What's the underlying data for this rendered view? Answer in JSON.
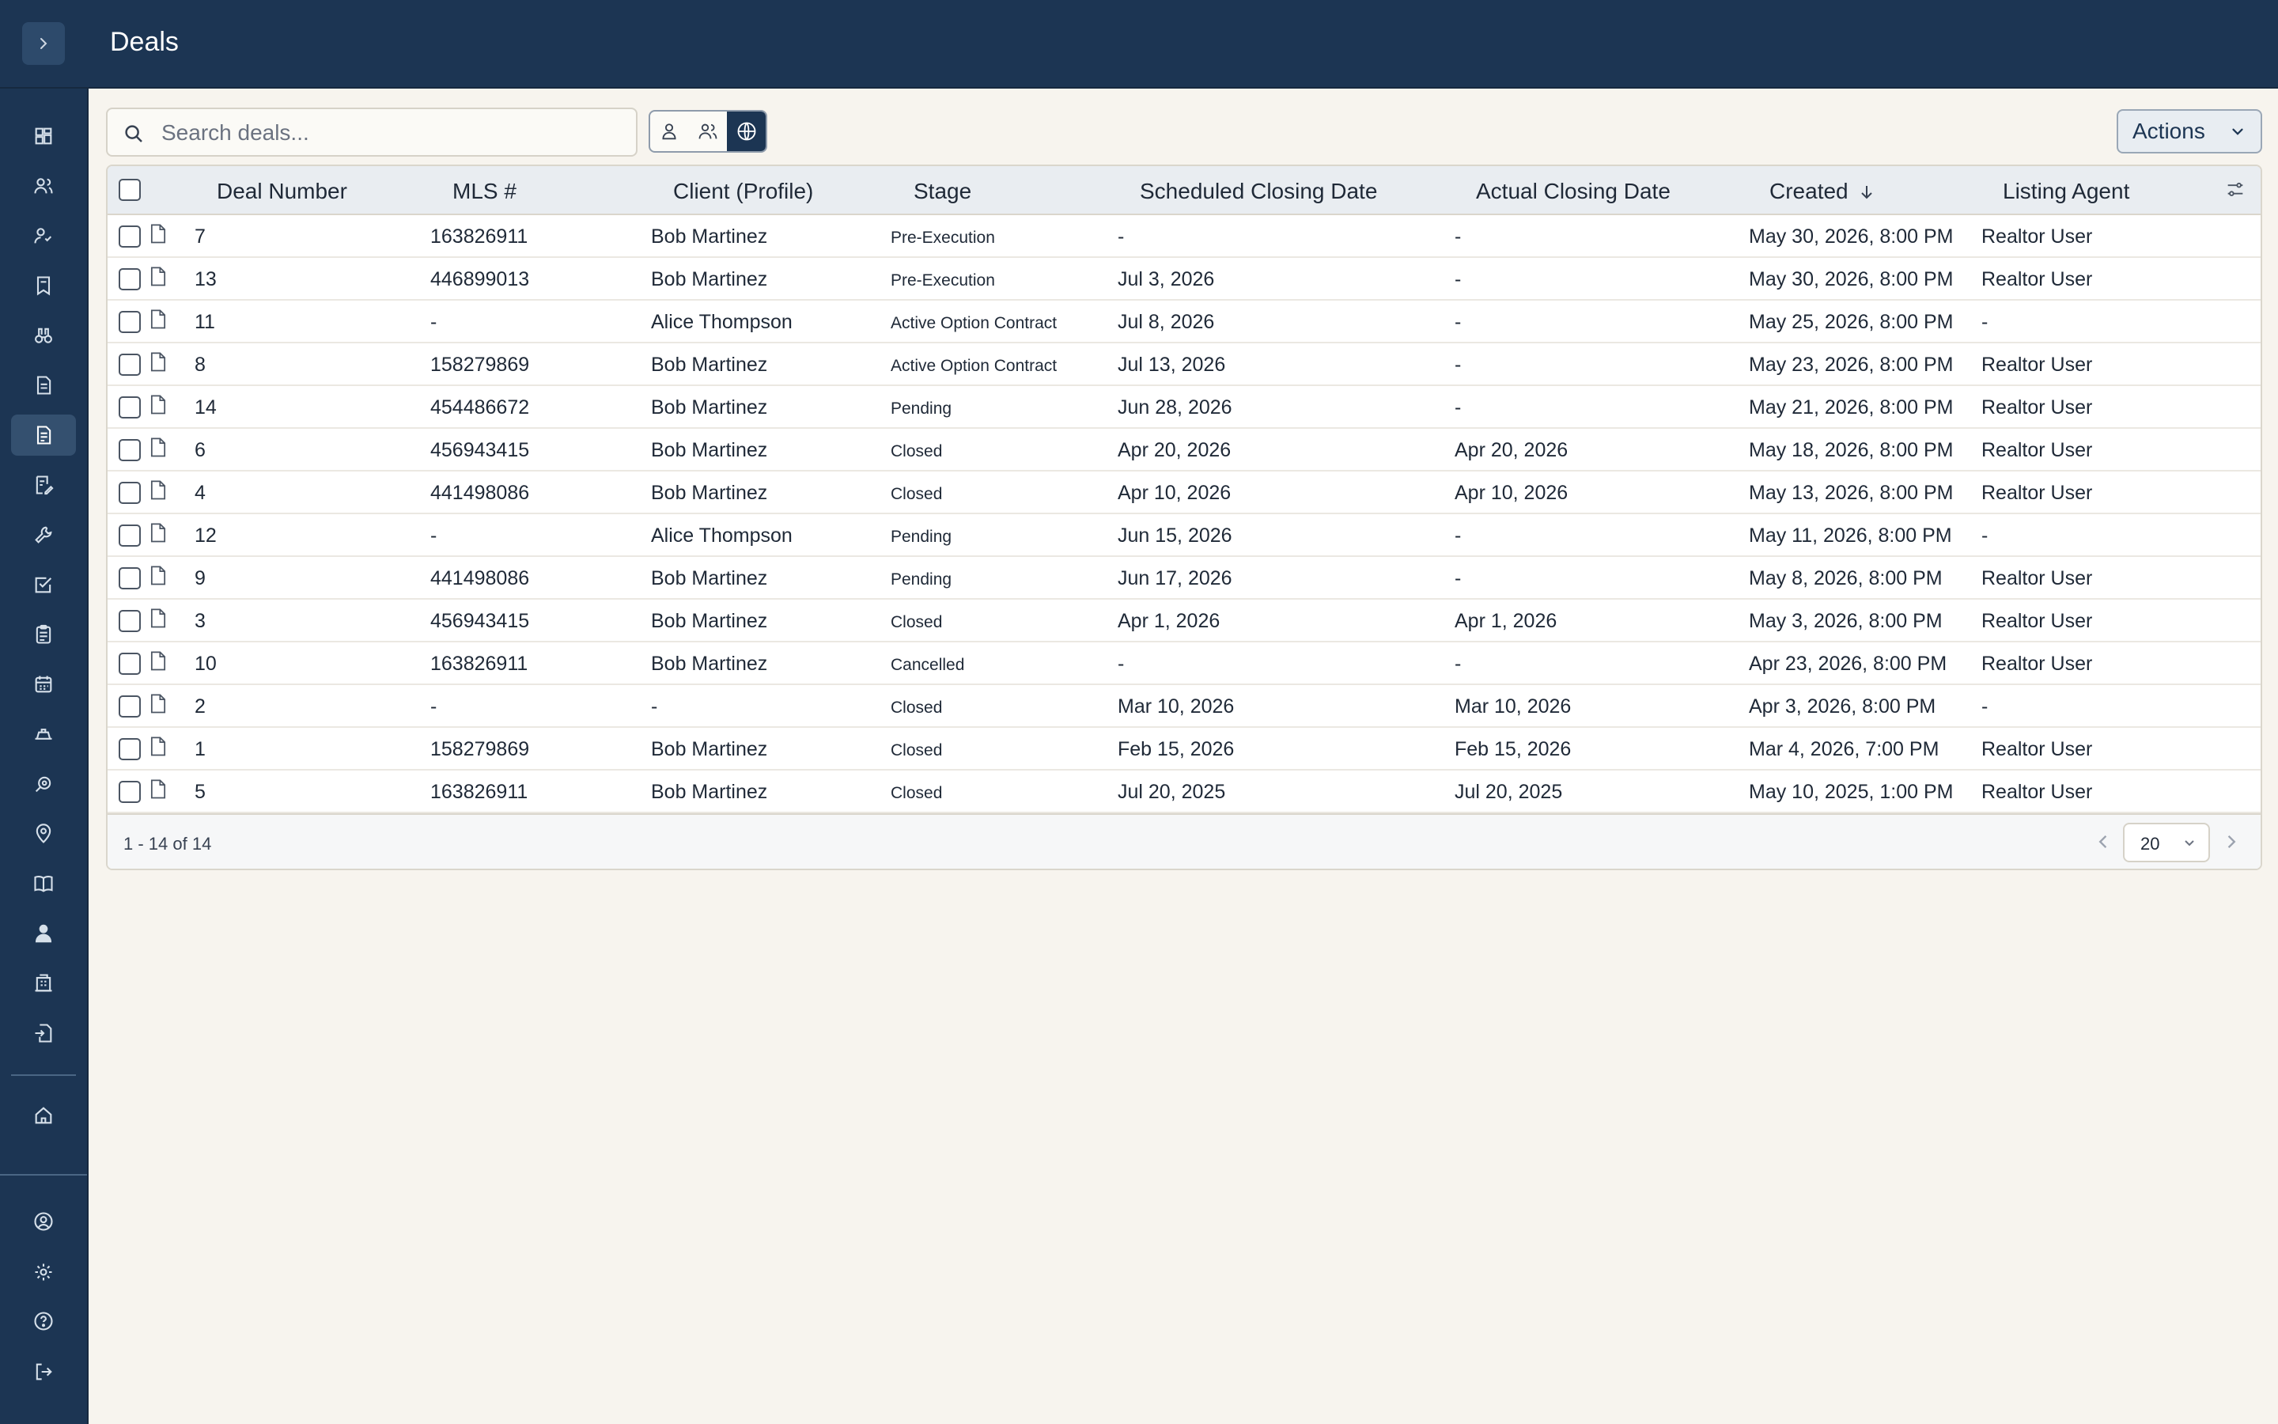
{
  "header": {
    "title": "Deals"
  },
  "search": {
    "placeholder": "Search deals..."
  },
  "scope_filters": [
    "my-deals",
    "team-deals",
    "all-deals"
  ],
  "actions": {
    "label": "Actions"
  },
  "sidebar": {
    "items": [
      "dashboard-icon",
      "contacts-icon",
      "clients-icon",
      "listings-icon",
      "showings-icon",
      "documents-icon",
      "deals-icon",
      "contracts-icon",
      "tools-icon",
      "tasks-icon",
      "checklists-icon",
      "calendar-icon",
      "offers-icon",
      "search-icon",
      "map-pin-icon",
      "book-icon",
      "agents-icon",
      "buildings-icon",
      "import-icon",
      "home-icon"
    ],
    "bottom": [
      "account-icon",
      "settings-icon",
      "help-icon",
      "logout-icon"
    ],
    "active_index": 6
  },
  "table": {
    "columns": {
      "deal_number": "Deal Number",
      "mls": "MLS #",
      "client": "Client (Profile)",
      "stage": "Stage",
      "scheduled": "Scheduled Closing Date",
      "actual": "Actual Closing Date",
      "created": "Created",
      "agent": "Listing Agent"
    },
    "sort": {
      "column": "Created",
      "direction": "descending"
    },
    "rows": [
      {
        "deal": "7",
        "mls": "163826911",
        "client": "Bob Martinez",
        "stage": "Pre-Execution",
        "scheduled": "-",
        "actual": "-",
        "created": "May 30, 2026, 8:00 PM",
        "agent": "Realtor User"
      },
      {
        "deal": "13",
        "mls": "446899013",
        "client": "Bob Martinez",
        "stage": "Pre-Execution",
        "scheduled": "Jul 3, 2026",
        "actual": "-",
        "created": "May 30, 2026, 8:00 PM",
        "agent": "Realtor User"
      },
      {
        "deal": "11",
        "mls": "-",
        "client": "Alice Thompson",
        "stage": "Active Option Contract",
        "scheduled": "Jul 8, 2026",
        "actual": "-",
        "created": "May 25, 2026, 8:00 PM",
        "agent": "-"
      },
      {
        "deal": "8",
        "mls": "158279869",
        "client": "Bob Martinez",
        "stage": "Active Option Contract",
        "scheduled": "Jul 13, 2026",
        "actual": "-",
        "created": "May 23, 2026, 8:00 PM",
        "agent": "Realtor User"
      },
      {
        "deal": "14",
        "mls": "454486672",
        "client": "Bob Martinez",
        "stage": "Pending",
        "scheduled": "Jun 28, 2026",
        "actual": "-",
        "created": "May 21, 2026, 8:00 PM",
        "agent": "Realtor User"
      },
      {
        "deal": "6",
        "mls": "456943415",
        "client": "Bob Martinez",
        "stage": "Closed",
        "scheduled": "Apr 20, 2026",
        "actual": "Apr 20, 2026",
        "created": "May 18, 2026, 8:00 PM",
        "agent": "Realtor User"
      },
      {
        "deal": "4",
        "mls": "441498086",
        "client": "Bob Martinez",
        "stage": "Closed",
        "scheduled": "Apr 10, 2026",
        "actual": "Apr 10, 2026",
        "created": "May 13, 2026, 8:00 PM",
        "agent": "Realtor User"
      },
      {
        "deal": "12",
        "mls": "-",
        "client": "Alice Thompson",
        "stage": "Pending",
        "scheduled": "Jun 15, 2026",
        "actual": "-",
        "created": "May 11, 2026, 8:00 PM",
        "agent": "-"
      },
      {
        "deal": "9",
        "mls": "441498086",
        "client": "Bob Martinez",
        "stage": "Pending",
        "scheduled": "Jun 17, 2026",
        "actual": "-",
        "created": "May 8, 2026, 8:00 PM",
        "agent": "Realtor User"
      },
      {
        "deal": "3",
        "mls": "456943415",
        "client": "Bob Martinez",
        "stage": "Closed",
        "scheduled": "Apr 1, 2026",
        "actual": "Apr 1, 2026",
        "created": "May 3, 2026, 8:00 PM",
        "agent": "Realtor User"
      },
      {
        "deal": "10",
        "mls": "163826911",
        "client": "Bob Martinez",
        "stage": "Cancelled",
        "scheduled": "-",
        "actual": "-",
        "created": "Apr 23, 2026, 8:00 PM",
        "agent": "Realtor User"
      },
      {
        "deal": "2",
        "mls": "-",
        "client": "-",
        "stage": "Closed",
        "scheduled": "Mar 10, 2026",
        "actual": "Mar 10, 2026",
        "created": "Apr 3, 2026, 8:00 PM",
        "agent": "-"
      },
      {
        "deal": "1",
        "mls": "158279869",
        "client": "Bob Martinez",
        "stage": "Closed",
        "scheduled": "Feb 15, 2026",
        "actual": "Feb 15, 2026",
        "created": "Mar 4, 2026, 7:00 PM",
        "agent": "Realtor User"
      },
      {
        "deal": "5",
        "mls": "163826911",
        "client": "Bob Martinez",
        "stage": "Closed",
        "scheduled": "Jul 20, 2025",
        "actual": "Jul 20, 2025",
        "created": "May 10, 2025, 1:00 PM",
        "agent": "Realtor User"
      }
    ]
  },
  "pagination": {
    "summary": "1 - 14 of 14",
    "page_size": "20"
  }
}
